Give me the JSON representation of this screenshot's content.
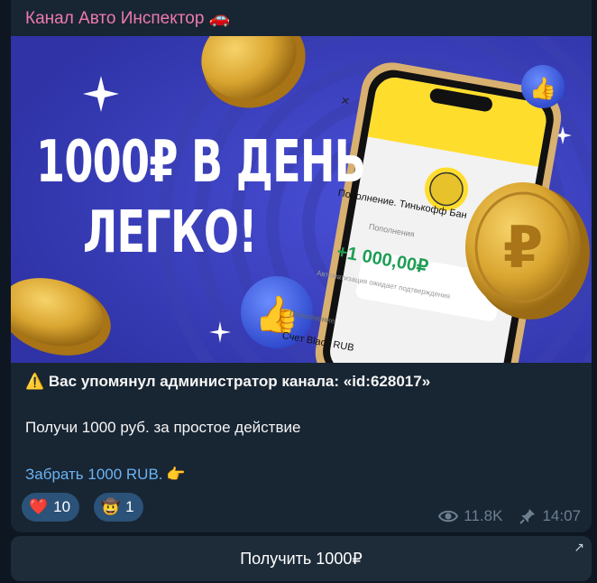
{
  "channel": {
    "name": "Канал Авто Инспектор",
    "emoji": "🚗"
  },
  "banner": {
    "headline_line1": "1000₽ В ДЕНЬ",
    "headline_line2": "ЛЕГКО!",
    "phone": {
      "close": "×",
      "topup_title": "Пополнение. Тинькофф Бан",
      "topup_label": "Пополнения",
      "amount": "+1 000,00₽",
      "pending": "Автоматизация ожидает подтверждения",
      "section": "Пополнение",
      "account": "Счет Black RUB"
    }
  },
  "message": {
    "warning_icon": "⚠️",
    "mention_line": "Вас упомянул администратор канала: «id:628017»",
    "body_line": "Получи 1000 руб. за простое действие",
    "link_text": "Забрать 1000 RUB.",
    "link_emoji": "👈"
  },
  "reactions": [
    {
      "emoji": "❤️",
      "count": "10"
    },
    {
      "emoji": "🤠",
      "count": "1"
    }
  ],
  "meta": {
    "views": "11.8K",
    "time": "14:07"
  },
  "button": {
    "label": "Получить 1000₽"
  },
  "colors": {
    "accent_name": "#ee7aae",
    "link": "#6ab3f3",
    "banner_bg": "#3a3fc0"
  }
}
